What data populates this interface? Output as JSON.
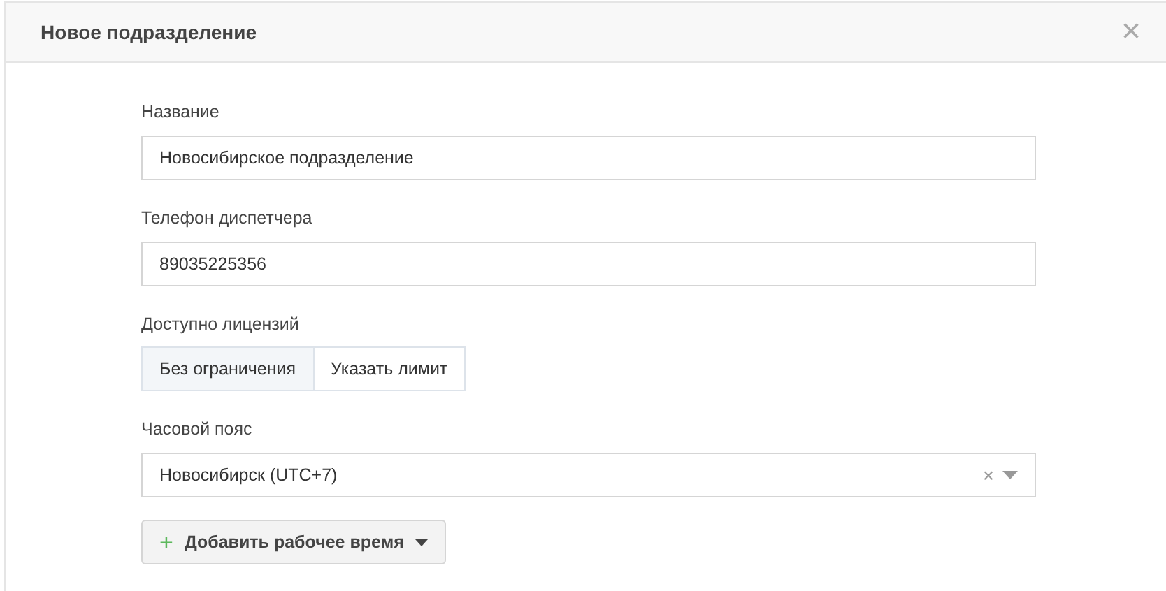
{
  "dialog": {
    "title": "Новое подразделение",
    "close": "×"
  },
  "fields": [
    {
      "kind": "text",
      "label": "Название",
      "value": "Новосибирское подразделение"
    },
    {
      "kind": "text",
      "label": "Телефон диспетчера",
      "value": "89035225356"
    },
    {
      "kind": "segmented",
      "label": "Доступно лицензий",
      "options": [
        {
          "label": "Без ограничения",
          "selected": true
        },
        {
          "label": "Указать лимит",
          "selected": false
        }
      ]
    },
    {
      "kind": "select",
      "label": "Часовой пояс",
      "value": "Новосибирск (UTC+7)",
      "clear": "×"
    }
  ],
  "add_button": {
    "icon": "+",
    "label": "Добавить рабочее время"
  }
}
